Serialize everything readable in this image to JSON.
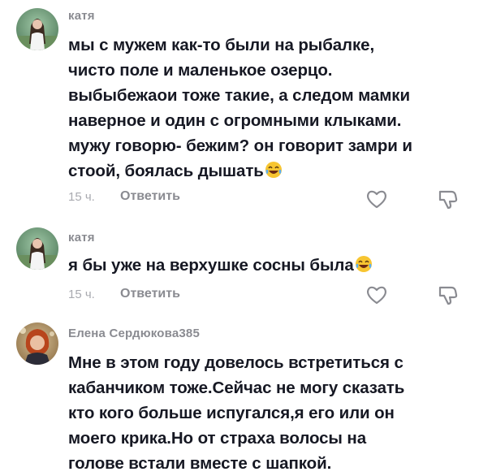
{
  "comments": [
    {
      "username": "катя",
      "text": "мы с мужем как-то были на рыбалке,\nчисто поле и маленькое озерцо.\nвыбыбежаои тоже такие, а следом мамки\nнаверное и один с огромными клыками.\nмужу говорю- бежим? он говорит замри и\nстоой, боялась дышать",
      "emoji": "laughing-tears-emoji",
      "time": "15 ч.",
      "reply_label": "Ответить"
    },
    {
      "username": "катя",
      "text": "я бы уже на верхушке сосны была",
      "emoji": "laughing-tears-emoji",
      "time": "15 ч.",
      "reply_label": "Ответить"
    },
    {
      "username": "Елена Сердюкова385",
      "text": "Мне в этом году довелось встретиться с\nкабанчиком тоже.Сейчас не могу сказать\nкто кого больше испугался,я его или он\nмоего крика.Но от страха волосы на\nголове встали вместе с шапкой."
    }
  ],
  "icons": {
    "like": "heart-outline-icon",
    "dislike": "thumb-down-outline-icon"
  },
  "colors": {
    "text": "#161823",
    "username": "#8a8b91",
    "time": "#a9aab0",
    "icon_stroke": "#8a8b91"
  }
}
